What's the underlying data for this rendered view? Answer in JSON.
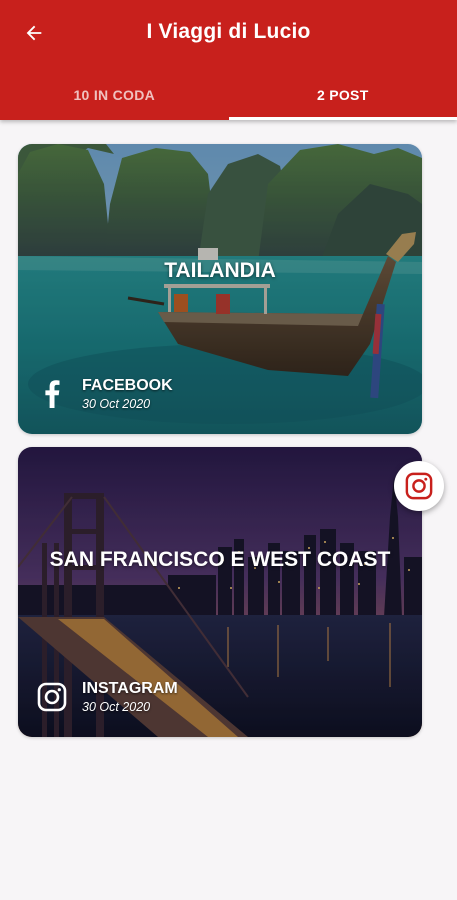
{
  "header": {
    "back_icon": "arrow-left-icon",
    "title": "I Viaggi di Lucio"
  },
  "tabs": [
    {
      "label": "10 IN CODA",
      "active": false
    },
    {
      "label": "2 POST",
      "active": true
    }
  ],
  "posts": [
    {
      "title": "TAILANDIA",
      "platform": "FACEBOOK",
      "platform_icon": "facebook-icon",
      "date": "30 Oct 2020"
    },
    {
      "title": "SAN FRANCISCO E WEST COAST",
      "platform": "INSTAGRAM",
      "platform_icon": "instagram-icon",
      "date": "30 Oct 2020"
    }
  ],
  "floating_action": {
    "icon": "instagram-icon"
  },
  "colors": {
    "primary": "#c8201c",
    "background": "#f7f5f7",
    "text_on_primary": "#ffffff"
  }
}
